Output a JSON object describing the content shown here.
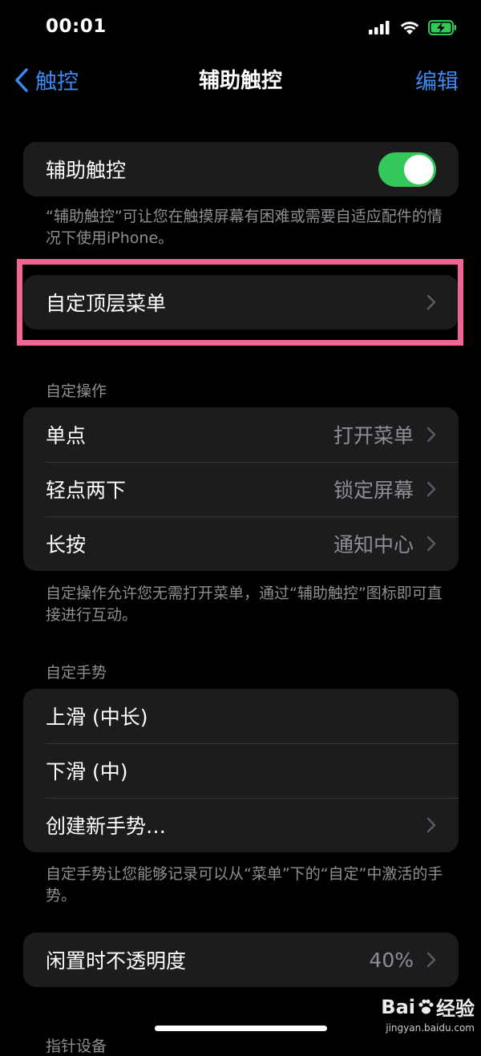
{
  "status_bar": {
    "time": "00:01"
  },
  "nav": {
    "back_label": "触控",
    "title": "辅助触控",
    "edit_label": "编辑"
  },
  "assistive_touch": {
    "label": "辅助触控",
    "enabled": true
  },
  "assistive_touch_footer": "“辅助触控”可让您在触摸屏幕有困难或需要自适应配件的情况下使用iPhone。",
  "top_menu": {
    "label": "自定顶层菜单"
  },
  "custom_actions": {
    "header": "自定操作",
    "rows": [
      {
        "label": "单点",
        "value": "打开菜单"
      },
      {
        "label": "轻点两下",
        "value": "锁定屏幕"
      },
      {
        "label": "长按",
        "value": "通知中心"
      }
    ],
    "footer": "自定操作允许您无需打开菜单，通过“辅助触控”图标即可直接进行互动。"
  },
  "custom_gestures": {
    "header": "自定手势",
    "rows": [
      {
        "label": "上滑 (中长)"
      },
      {
        "label": "下滑 (中)"
      },
      {
        "label": "创建新手势…"
      }
    ],
    "footer": "自定手势让您能够记录可以从“菜单”下的“自定”中激活的手势。"
  },
  "idle_opacity": {
    "label": "闲置时不透明度",
    "value": "40%"
  },
  "next_section_header_partial": "指针设备",
  "watermark": {
    "brand": "Bai",
    "brand2": "经验",
    "url": "jingyan.baidu.com"
  },
  "colors": {
    "accent": "#3a8bf4",
    "toggle_on": "#34c759",
    "highlight": "#f06593",
    "card": "#1c1c1e"
  },
  "battery": {
    "charging": true,
    "color": "#34c759"
  }
}
